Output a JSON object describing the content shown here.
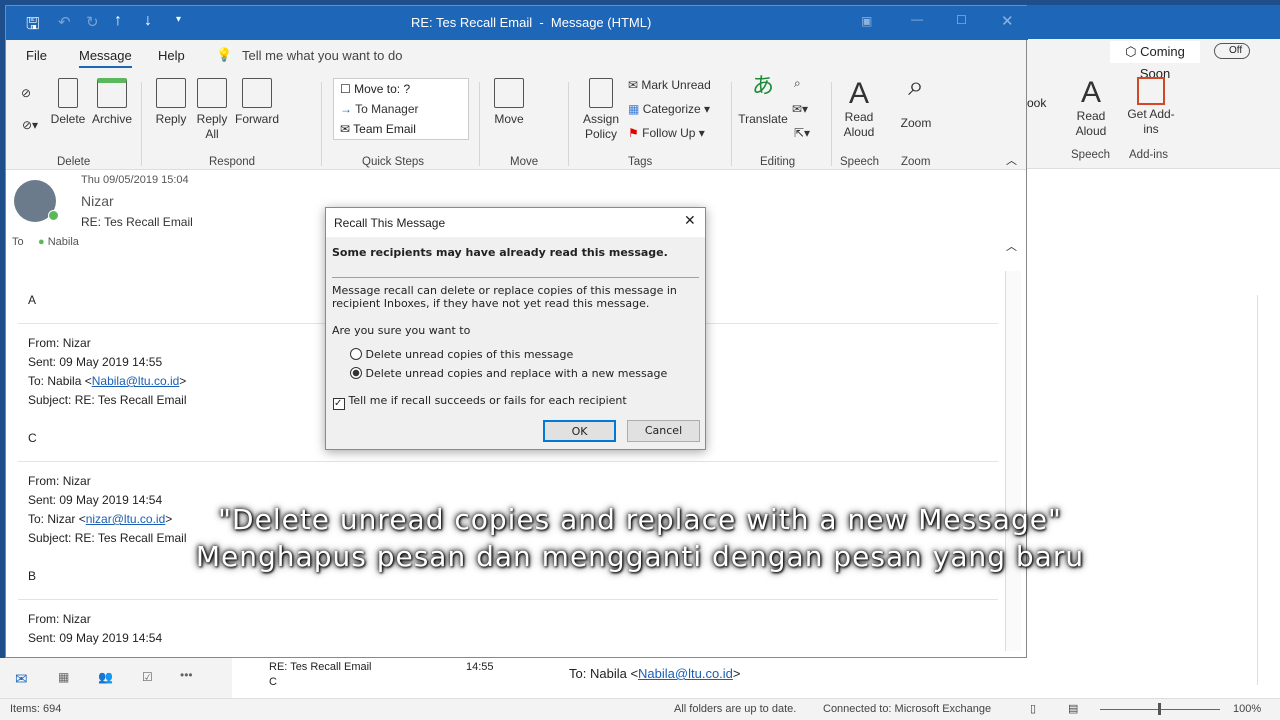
{
  "window": {
    "title": "RE: Tes Recall Email  -  Message (HTML)"
  },
  "tabs": [
    {
      "label": "File"
    },
    {
      "label": "Message"
    },
    {
      "label": "Help"
    }
  ],
  "tell_me": "Tell me what you want to do",
  "ribbon": {
    "delete": {
      "delete": "Delete",
      "archive": "Archive",
      "group": "Delete"
    },
    "respond": {
      "reply": "Reply",
      "reply_all": "Reply All",
      "forward": "Forward",
      "group": "Respond"
    },
    "quick_steps": {
      "items": [
        "Move to: ?",
        "To Manager",
        "Team Email"
      ],
      "group": "Quick Steps"
    },
    "move": {
      "move": "Move",
      "group": "Move"
    },
    "tags": {
      "assign_policy": "Assign Policy",
      "mark_unread": "Mark Unread",
      "categorize": "Categorize",
      "follow_up": "Follow Up",
      "group": "Tags"
    },
    "editing": {
      "translate": "Translate",
      "group": "Editing"
    },
    "speech": {
      "read_aloud": "Read Aloud",
      "group": "Speech"
    },
    "zoom": {
      "zoom": "Zoom",
      "group": "Zoom"
    }
  },
  "back_window": {
    "coming_soon": "Coming Soon",
    "toggle": "Off",
    "partial": "ook",
    "read_aloud": "Read Aloud",
    "get_addins": "Get Add-ins",
    "speech": "Speech",
    "addins": "Add-ins"
  },
  "header": {
    "date": "Thu 09/05/2019 15:04",
    "sender": "Nizar",
    "subject": "RE: Tes Recall Email",
    "to_label": "To",
    "to": "Nabila"
  },
  "body": [
    {
      "text": "A"
    },
    {
      "from": "Nizar",
      "sent": "09 May 2019 14:55",
      "to_name": "Nabila",
      "to_email": "Nabila@ltu.co.id",
      "subject": "RE: Tes Recall Email",
      "text": "C"
    },
    {
      "from": "Nizar",
      "sent": "09 May 2019 14:54",
      "to_name": "Nizar",
      "to_email": "nizar@ltu.co.id",
      "subject": "RE: Tes Recall Email",
      "text": "B"
    },
    {
      "from": "Nizar",
      "sent": "09 May 2019 14:54"
    }
  ],
  "labels": {
    "from": "From:",
    "sent": "Sent:",
    "to": "To:",
    "subject": "Subject:"
  },
  "dialog": {
    "title": "Recall This Message",
    "warning": "Some recipients may have already read this message.",
    "info": "Message recall can delete or replace copies of this message in recipient Inboxes, if they have not yet read this message.",
    "question": "Are you sure you want to",
    "option1": "Delete unread copies of this message",
    "option2": "Delete unread copies and replace with a new message",
    "selected": 2,
    "checkbox": "Tell me if recall succeeds or fails for each recipient",
    "checked": true,
    "ok": "OK",
    "cancel": "Cancel"
  },
  "caption": {
    "line1": "\"Delete unread copies and replace with a new Message\"",
    "line2": "Menghapus pesan dan mengganti dengan pesan yang baru"
  },
  "message_list": {
    "subject": "RE: Tes Recall Email",
    "time": "14:55",
    "preview": "C"
  },
  "reading_pane": {
    "to_label": "To:",
    "to_name": "Nabila",
    "to_email": "Nabila@ltu.co.id"
  },
  "status": {
    "items": "Items: 694",
    "sync": "All folders are up to date.",
    "connection": "Connected to: Microsoft Exchange",
    "zoom": "100%"
  },
  "colors": {
    "titlebar": "#1d66b8",
    "accent": "#1a5fb4",
    "addins": "#d24726"
  }
}
